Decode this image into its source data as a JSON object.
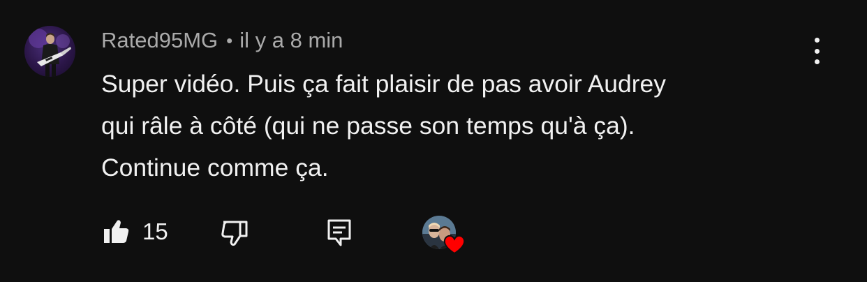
{
  "comment": {
    "author": "Rated95MG",
    "separator": "•",
    "timestamp": "il y a 8 min",
    "text_lines": [
      "Super vidéo. Puis ça fait plaisir de pas avoir Audrey",
      "qui râle à côté (qui ne passe son temps qu'à ça).",
      "Continue comme ça."
    ],
    "like_count": "15"
  },
  "icons": {
    "more": "more-vert-icon",
    "like": "thumb-up-icon",
    "dislike": "thumb-down-icon",
    "reply": "reply-comment-icon",
    "heart": "heart-icon"
  },
  "colors": {
    "background": "#0f0f0f",
    "text_primary": "#f1f1f1",
    "text_secondary": "#aaaaaa",
    "heart": "#ff0000"
  }
}
